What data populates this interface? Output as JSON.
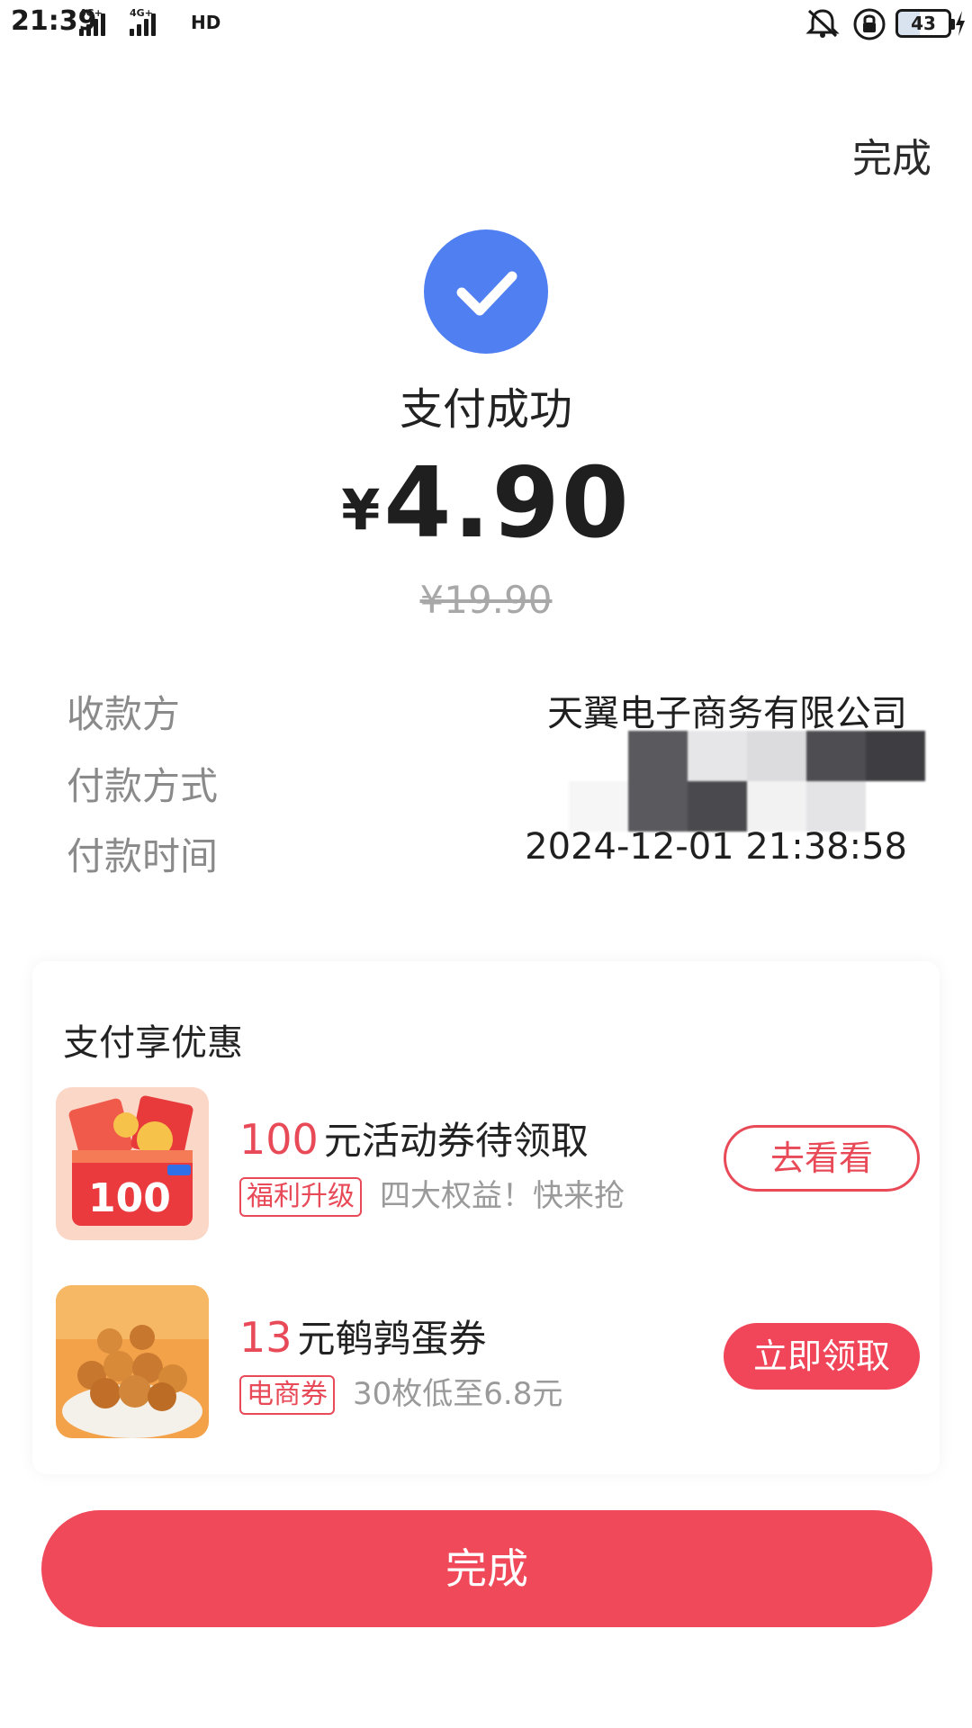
{
  "status_bar": {
    "time": "21:39",
    "signal_1_label": "4G+",
    "signal_2_label": "4G+",
    "hd_label": "HD",
    "battery_level": "43",
    "icons": [
      "signal-icon",
      "signal-icon",
      "hd-icon",
      "mute-bell-icon",
      "rotation-lock-icon",
      "battery-icon",
      "charging-icon"
    ]
  },
  "header": {
    "done_label": "完成"
  },
  "result": {
    "title": "支付成功",
    "currency": "¥",
    "amount": "4.90",
    "original_price": "¥19.90"
  },
  "details": [
    {
      "label": "收款方",
      "value": "天翼电子商务有限公司"
    },
    {
      "label": "付款方式",
      "value": ""
    },
    {
      "label": "付款时间",
      "value": "2024-12-01 21:38:58"
    }
  ],
  "promotions": {
    "title": "支付享优惠",
    "items": [
      {
        "amount": "100",
        "headline": "元活动券待领取",
        "tag": "福利升级",
        "description": "四大权益！快来抢",
        "button": "去看看",
        "thumb_label": "100"
      },
      {
        "amount": "13",
        "headline": "元鹌鹑蛋券",
        "tag": "电商券",
        "description": "30枚低至6.8元",
        "button": "立即领取"
      }
    ]
  },
  "footer": {
    "done_button": "完成"
  },
  "colors": {
    "accent_red": "#f0495a",
    "success_blue": "#4f7ff1"
  }
}
